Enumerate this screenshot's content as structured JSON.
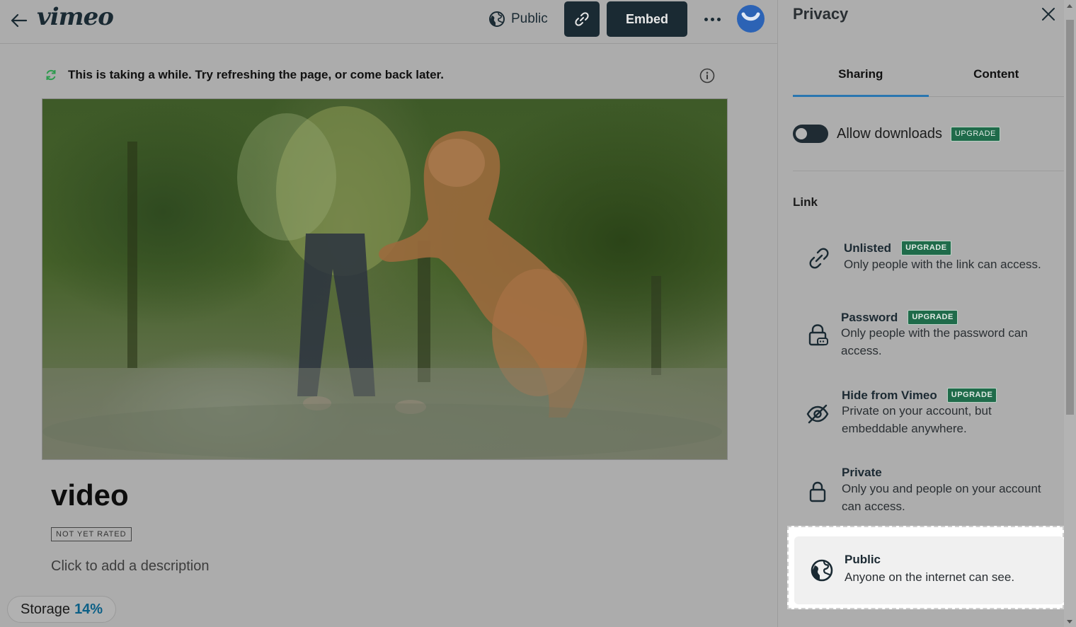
{
  "header": {
    "logo": "vimeo",
    "privacy_button_label": "Public",
    "embed_label": "Embed"
  },
  "notice": {
    "text": "This is taking a while. Try refreshing the page, or come back later."
  },
  "video": {
    "title": "video",
    "rating": "NOT YET RATED",
    "description_placeholder": "Click to add a description"
  },
  "storage": {
    "label": "Storage",
    "percent": "14%"
  },
  "panel": {
    "title": "Privacy",
    "tabs": [
      {
        "label": "Sharing",
        "active": true
      },
      {
        "label": "Content",
        "active": false
      }
    ],
    "allow_downloads": {
      "label": "Allow downloads",
      "enabled": false,
      "badge": "UPGRADE"
    },
    "link_section_label": "Link",
    "options": [
      {
        "icon": "link-icon",
        "title": "Unlisted",
        "badge": "UPGRADE",
        "description": "Only people with the link can access."
      },
      {
        "icon": "password-lock-icon",
        "title": "Password",
        "badge": "UPGRADE",
        "description": "Only people with the password can access."
      },
      {
        "icon": "eye-off-icon",
        "title": "Hide from Vimeo",
        "badge": "UPGRADE",
        "description": "Private on your account, but embeddable anywhere."
      },
      {
        "icon": "lock-icon",
        "title": "Private",
        "badge": "",
        "description": "Only you and people on your account can access."
      },
      {
        "icon": "globe-icon",
        "title": "Public",
        "badge": "",
        "description": "Anyone on the internet can see.",
        "selected": true
      }
    ]
  },
  "colors": {
    "accent": "#2a76b0",
    "dark": "#1a2a33",
    "upgrade_badge": "#1f6b4a",
    "storage_percent": "#0b5f86"
  }
}
